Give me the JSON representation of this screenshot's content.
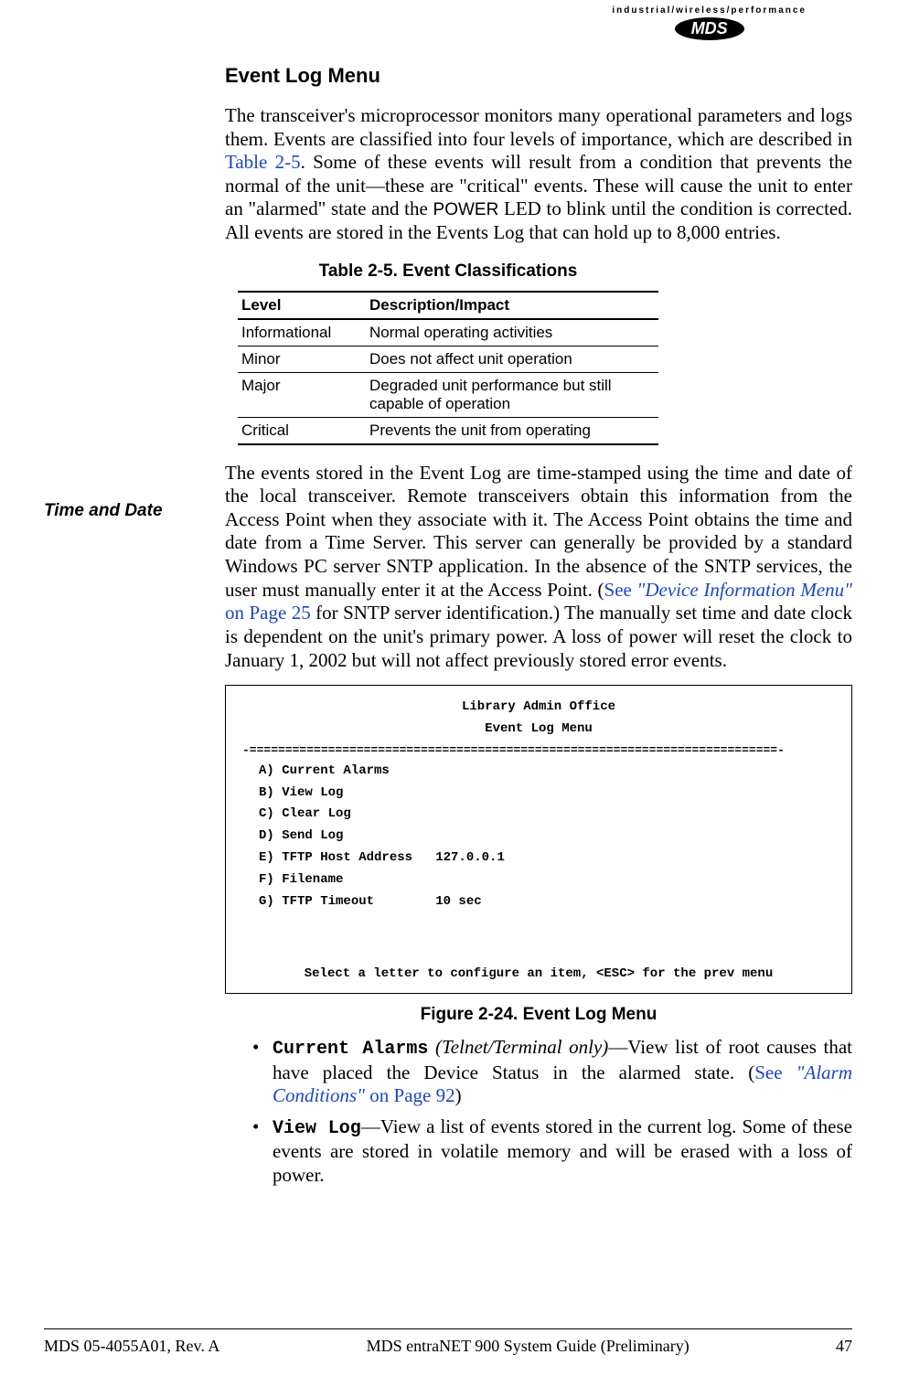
{
  "logo": {
    "tagline": "industrial/wireless/performance",
    "brand": "MDS"
  },
  "heading": "Event Log Menu",
  "para1_a": "The transceiver's microprocessor monitors many operational parameters and logs them. Events are classified into four levels of importance, which are described in ",
  "para1_link": "Table 2-5",
  "para1_b": ". Some of these events will result from a condition that prevents the normal of the unit—these are \"critical\" events. These will cause the unit to enter an \"alarmed\" state and the ",
  "para1_power": "POWER",
  "para1_c": " LED to blink until the condition is corrected. All events are stored in the Events Log that can hold up to 8,000 entries.",
  "table": {
    "caption": "Table 2-5. Event Classifications",
    "h1": "Level",
    "h2": "Description/Impact",
    "rows": [
      {
        "c1": "Informational",
        "c2": "Normal operating activities"
      },
      {
        "c1": "Minor",
        "c2": "Does not affect unit operation"
      },
      {
        "c1": "Major",
        "c2": "Degraded unit performance but still capable of operation"
      },
      {
        "c1": "Critical",
        "c2": "Prevents the unit from operating"
      }
    ]
  },
  "margin_label": "Time and Date",
  "para2_a": "The events stored in the Event Log are time-stamped using the time and date of the local transceiver. Remote transceivers obtain this information from the Access Point when they associate with it. The Access Point obtains the time and date from a Time Server. This server can generally be provided by a standard Windows PC server SNTP application. In the absence of the SNTP services, the user must manually enter it at the Access Point. (",
  "para2_see": "See ",
  "para2_link1": "\"Device Information Menu\"",
  "para2_on": " on Page 25",
  "para2_b": " for SNTP server identification.) The manually set time and date clock is dependent on the unit's primary power. A loss of power will reset the clock to January 1, 2002 but will not affect previously stored error events.",
  "terminal": {
    "title1": "Library Admin Office",
    "title2": "Event Log Menu",
    "divider": "-==========================================================================-",
    "items": [
      "A) Current Alarms",
      "B) View Log",
      "C) Clear Log",
      "D) Send Log",
      "E) TFTP Host Address   127.0.0.1",
      "F) Filename",
      "G) TFTP Timeout        10 sec"
    ],
    "prompt": "Select a letter to configure an item, <ESC> for the prev menu"
  },
  "figure_caption": "Figure 2-24. Event Log Menu",
  "bullets": {
    "b1_name": "Current Alarms",
    "b1_note": " (Telnet/Terminal only)",
    "b1_a": "—View list of root causes that have placed the Device Status in the alarmed state. (",
    "b1_see": "See ",
    "b1_link": "\"Alarm Conditions\"",
    "b1_on": " on Page 92",
    "b1_b": ")",
    "b2_name": "View Log",
    "b2_a": "—View a list of events stored in the current log. Some of these events are stored in volatile memory and will be erased with a loss of power."
  },
  "footer": {
    "left": "MDS 05-4055A01, Rev. A",
    "center": "MDS entraNET 900 System Guide (Preliminary)",
    "right": "47"
  }
}
